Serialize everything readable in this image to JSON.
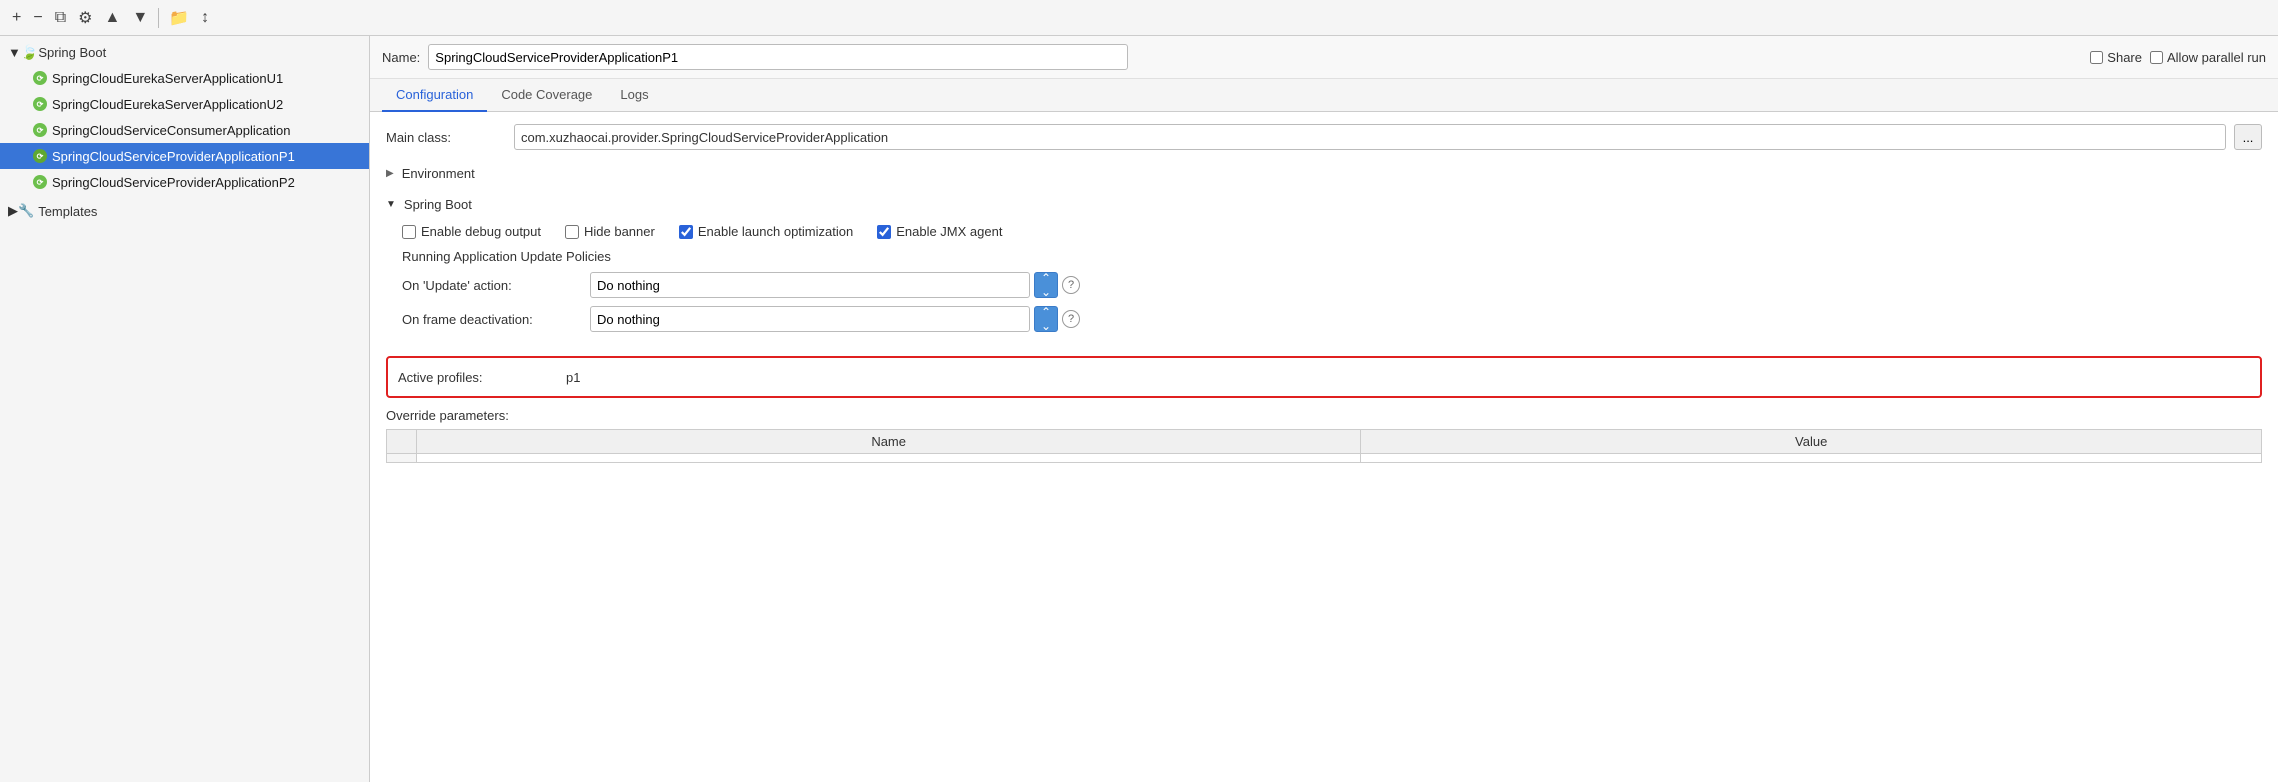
{
  "toolbar": {
    "add_btn": "+",
    "remove_btn": "−",
    "copy_btn": "⧉",
    "settings_btn": "⚙",
    "up_btn": "▲",
    "down_btn": "▼",
    "folder_btn": "📁",
    "sort_btn": "↕"
  },
  "sidebar": {
    "spring_boot_group": "Spring Boot",
    "spring_boot_chevron": "▼",
    "items": [
      {
        "label": "SpringCloudEurekaServerApplicationU1",
        "selected": false
      },
      {
        "label": "SpringCloudEurekaServerApplicationU2",
        "selected": false
      },
      {
        "label": "SpringCloudServiceConsumerApplication",
        "selected": false
      },
      {
        "label": "SpringCloudServiceProviderApplicationP1",
        "selected": true
      },
      {
        "label": "SpringCloudServiceProviderApplicationP2",
        "selected": false
      }
    ],
    "templates_group": "Templates",
    "templates_chevron": "▶"
  },
  "name_bar": {
    "label": "Name:",
    "value": "SpringCloudServiceProviderApplicationP1",
    "share_label": "Share",
    "allow_parallel_label": "Allow parallel run"
  },
  "tabs": [
    {
      "label": "Configuration",
      "active": true
    },
    {
      "label": "Code Coverage",
      "active": false
    },
    {
      "label": "Logs",
      "active": false
    }
  ],
  "config": {
    "main_class_label": "Main class:",
    "main_class_value": "com.xuzhaocai.provider.SpringCloudServiceProviderApplication",
    "ellipsis": "...",
    "environment_label": "Environment",
    "environment_chevron": "▶",
    "spring_boot_section": "Spring Boot",
    "spring_boot_chevron": "▼",
    "checkboxes": [
      {
        "label": "Enable debug output",
        "checked": false
      },
      {
        "label": "Hide banner",
        "checked": false
      },
      {
        "label": "Enable launch optimization",
        "checked": true
      },
      {
        "label": "Enable JMX agent",
        "checked": true
      }
    ],
    "policies_label": "Running Application Update Policies",
    "on_update_label": "On 'Update' action:",
    "on_update_value": "Do nothing",
    "on_frame_label": "On frame deactivation:",
    "on_frame_value": "Do nothing",
    "active_profiles_label": "Active profiles:",
    "active_profiles_value": "p1",
    "override_label": "Override parameters:",
    "override_table_headers": [
      "",
      "Name",
      "Value"
    ]
  }
}
